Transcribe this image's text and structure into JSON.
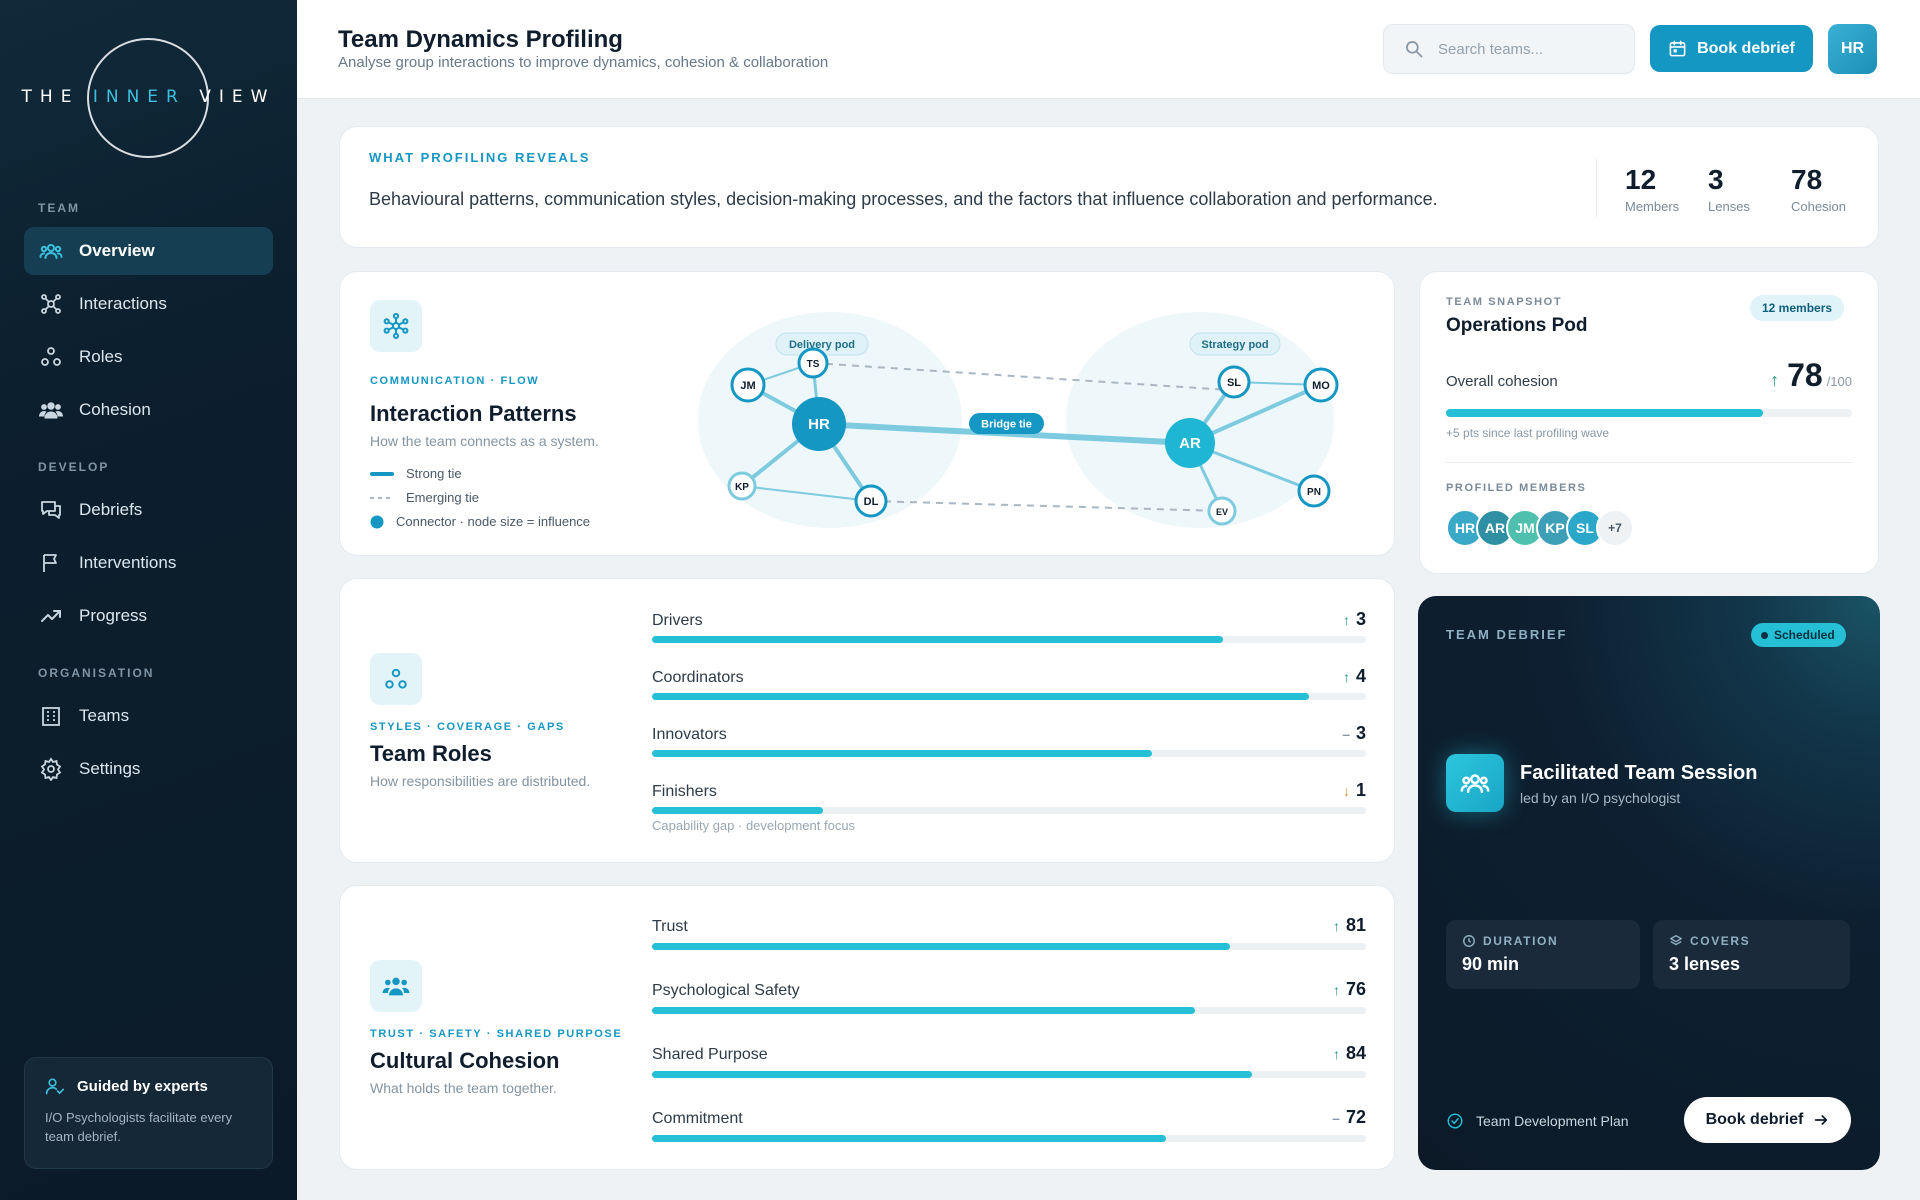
{
  "brand": {
    "part1": "THE ",
    "part2": "INNER",
    "part3": " VIEW"
  },
  "sidebar": {
    "sections": [
      {
        "label": "TEAM"
      },
      {
        "label": "DEVELOP"
      },
      {
        "label": "ORGANISATION"
      }
    ],
    "items": [
      {
        "label": "Overview",
        "icon": "team-icon",
        "active": true
      },
      {
        "label": "Interactions",
        "icon": "network-icon"
      },
      {
        "label": "Roles",
        "icon": "roles-icon"
      },
      {
        "label": "Cohesion",
        "icon": "group-icon"
      },
      {
        "label": "Debriefs",
        "icon": "chat-icon"
      },
      {
        "label": "Interventions",
        "icon": "flag-icon"
      },
      {
        "label": "Progress",
        "icon": "trend-up-icon"
      },
      {
        "label": "Teams",
        "icon": "building-icon"
      },
      {
        "label": "Settings",
        "icon": "gear-icon"
      }
    ],
    "guide": {
      "title": "Guided by experts",
      "text": "I/O Psychologists facilitate every team debrief."
    }
  },
  "header": {
    "title": "Team Dynamics Profiling",
    "subtitle": "Analyse group interactions to improve dynamics, cohesion & collaboration",
    "search_placeholder": "Search teams...",
    "book_label": "Book debrief",
    "avatar": "HR"
  },
  "reveals": {
    "eyebrow": "WHAT PROFILING REVEALS",
    "text": "Behavioural patterns, communication styles, decision-making processes, and the factors that influence collaboration and performance.",
    "stats": [
      {
        "value": "12",
        "label": "Members"
      },
      {
        "value": "3",
        "label": "Lenses"
      },
      {
        "value": "78",
        "label": "Cohesion"
      }
    ]
  },
  "interaction": {
    "eyebrow": "COMMUNICATION · FLOW",
    "title": "Interaction Patterns",
    "desc": "How the team connects as a system.",
    "legend": {
      "strong": "Strong tie",
      "emerging": "Emerging tie",
      "connector": "Connector · node size = influence"
    },
    "graph": {
      "pod_left": "Delivery pod",
      "pod_right": "Strategy pod",
      "bridge": "Bridge tie",
      "nodes": {
        "jm": "JM",
        "ts": "TS",
        "hr": "HR",
        "kp": "KP",
        "dl": "DL",
        "sl": "SL",
        "mo": "MO",
        "ar": "AR",
        "ev": "EV",
        "pn": "PN"
      }
    }
  },
  "roles": {
    "eyebrow": "STYLES · COVERAGE · GAPS",
    "title": "Team Roles",
    "desc": "How responsibilities are distributed.",
    "items": [
      {
        "label": "Drivers",
        "value": "3",
        "trend": "↑",
        "fill": 0.8
      },
      {
        "label": "Coordinators",
        "value": "4",
        "trend": "↑",
        "fill": 0.92
      },
      {
        "label": "Innovators",
        "value": "3",
        "trend": "–",
        "fill": 0.7
      },
      {
        "label": "Finishers",
        "value": "1",
        "trend": "↓",
        "fill": 0.24
      }
    ],
    "note": "Capability gap · development focus"
  },
  "cohesion": {
    "eyebrow": "TRUST · SAFETY · SHARED PURPOSE",
    "title": "Cultural Cohesion",
    "desc": "What holds the team together.",
    "items": [
      {
        "label": "Trust",
        "value": "81",
        "trend": "↑",
        "fill": 0.81
      },
      {
        "label": "Psychological Safety",
        "value": "76",
        "trend": "↑",
        "fill": 0.76
      },
      {
        "label": "Shared Purpose",
        "value": "84",
        "trend": "↑",
        "fill": 0.84
      },
      {
        "label": "Commitment",
        "value": "72",
        "trend": "–",
        "fill": 0.72
      }
    ]
  },
  "snapshot": {
    "eyebrow": "TEAM SNAPSHOT",
    "team": "Operations Pod",
    "pill": "12 members",
    "cohesion_label": "Overall cohesion",
    "score": "78",
    "score_max": "/100",
    "score_fill": 0.78,
    "delta": "+5 pts since last profiling wave",
    "members_label": "PROFILED MEMBERS",
    "members": [
      "HR",
      "AR",
      "JM",
      "KP",
      "SL"
    ],
    "more": "+7"
  },
  "debrief": {
    "eyebrow": "TEAM DEBRIEF",
    "status": "Scheduled",
    "title": "Facilitated Team Session",
    "sub": "led by an I/O psychologist",
    "duration_label": "DURATION",
    "duration": "90 min",
    "covers_label": "COVERS",
    "covers": "3 lenses",
    "plan": "Team Development Plan",
    "cta": "Book debrief"
  },
  "colors": {
    "accent": "#1597c4",
    "bar": "#25c0d6",
    "sidebar": "#0c1f2e"
  }
}
